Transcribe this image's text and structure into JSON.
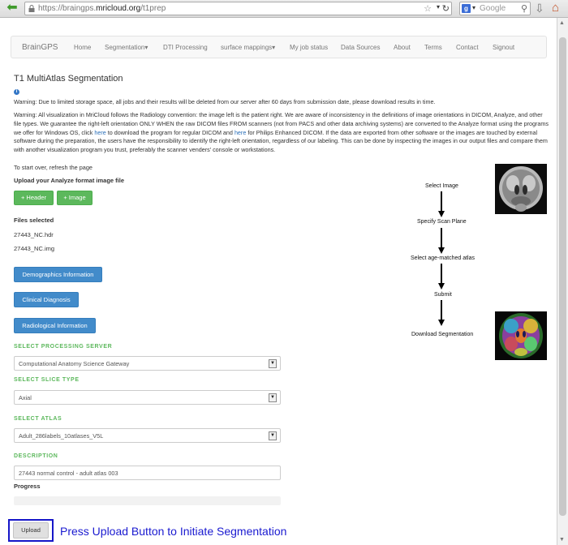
{
  "browser": {
    "url_prefix": "https://braingps.",
    "url_domain": "mricloud.org",
    "url_path": "/t1prep",
    "search_placeholder": "Google"
  },
  "navbar": {
    "brand": "BrainGPS",
    "items": [
      "Home",
      "Segmentation▾",
      "DTI Processing",
      "surface mappings▾",
      "My job status",
      "Data Sources",
      "About",
      "Terms",
      "Contact",
      "Signout"
    ]
  },
  "page": {
    "title": "T1 MultiAtlas Segmentation",
    "warning1": "Warning: Due to limited storage space, all jobs and their results will be deleted from our server after 60 days from submission date, please download results in time.",
    "warning2_a": "Warning: All visualization in MriCloud follows the Radiology convention: the image left is the patient right. We are aware of inconsistency in the definitions of image orientations in DICOM, Analyze, and other file types. We guarantee the right-left orientation ONLY WHEN the raw DICOM files FROM scanners (not from PACS and other data archiving systems) are converted to the Analyze format using the programs we offer for Windows OS, click",
    "warning2_link1": "here",
    "warning2_b": "to download the program for regular DICOM and",
    "warning2_link2": "here",
    "warning2_c": "for Philips Enhanced DICOM. If the data are exported from other software or the images are touched by external software during the preparation, the users have the responsibility to identify the right-left orientation, regardless of our labeling. This can be done by inspecting the images in our output files and compare them with another visualization program you trust, preferably the scanner venders' console or workstations.",
    "refresh_text": "To start over, refresh the page",
    "upload_heading": "Upload your Analyze format image file",
    "header_button": "+ Header",
    "image_button": "+ Image",
    "files_heading": "Files selected",
    "files": [
      "27443_NC.hdr",
      "27443_NC.img"
    ],
    "demographics_button": "Demographics Information",
    "clinical_button": "Clinical Diagnosis",
    "radiological_button": "Radiological Information",
    "server_label": "SELECT PROCESSING SERVER",
    "server_value": "Computational Anatomy Science Gateway",
    "slice_label": "SELECT SLICE TYPE",
    "slice_value": "Axial",
    "atlas_label": "SELECT ATLAS",
    "atlas_value": "Adult_286labels_10atlases_V5L",
    "description_label": "DESCRIPTION",
    "description_value": "27443 normal control - adult atlas 003",
    "progress_heading": "Progress",
    "progress_value": 0,
    "upload_button": "Upload",
    "annotation": "Press Upload Button to Initiate Segmentation"
  },
  "workflow": {
    "steps": [
      "Select Image",
      "Specify Scan Plane",
      "Select age-matched atlas",
      "Submit",
      "Download Segmentation"
    ]
  },
  "colors": {
    "green": "#5cb85c",
    "blue": "#428bca",
    "highlight": "#1616c8"
  }
}
